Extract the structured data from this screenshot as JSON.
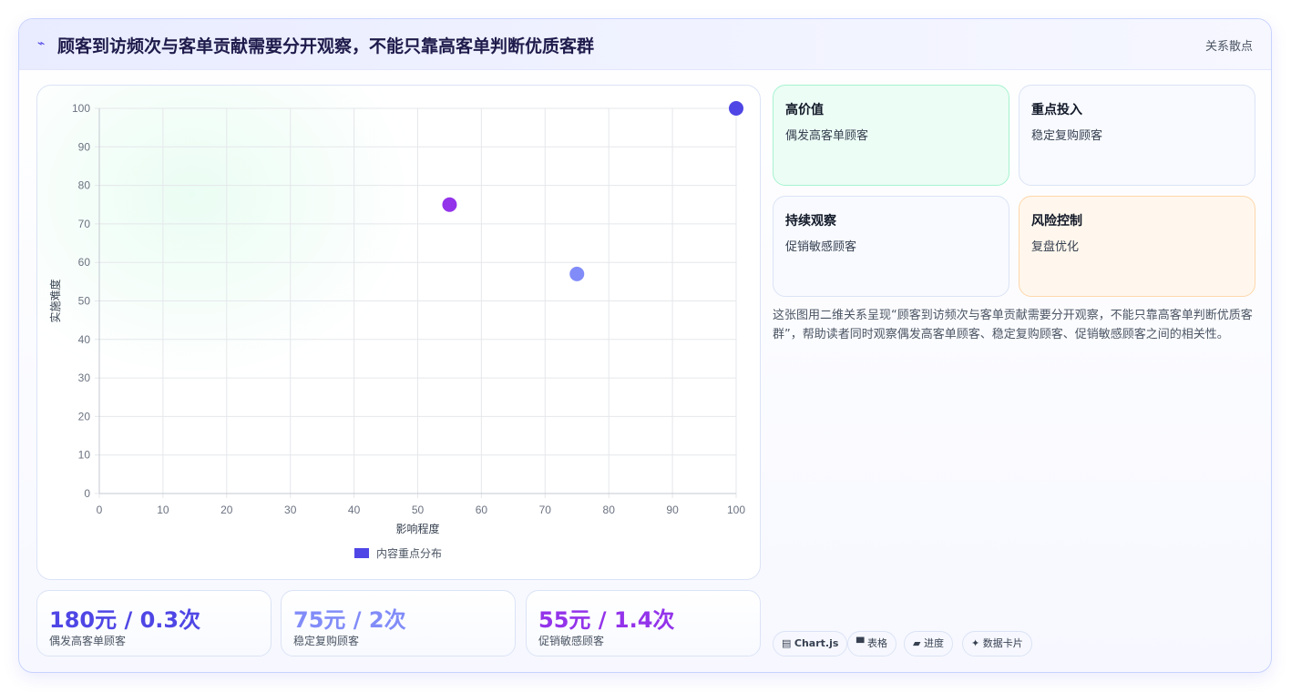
{
  "header": {
    "icon": "lightning-icon",
    "title": "顾客到访频次与客单贡献需要分开观察，不能只靠高客单判断优质客群",
    "tag": "关系散点"
  },
  "chart_data": {
    "type": "scatter",
    "xlabel": "影响程度",
    "ylabel": "实施难度",
    "xlim": [
      0,
      100
    ],
    "ylim": [
      0,
      100
    ],
    "x_ticks": [
      "0",
      "10",
      "20",
      "30",
      "40",
      "50",
      "60",
      "70",
      "80",
      "90",
      "100"
    ],
    "y_ticks": [
      "0",
      "10",
      "20",
      "30",
      "40",
      "50",
      "60",
      "70",
      "80",
      "90",
      "100"
    ],
    "grid": true,
    "legend": {
      "label": "内容重点分布",
      "placement": "bottom",
      "color": "#4f46e5"
    },
    "points": [
      {
        "x": 100,
        "y": 100,
        "color": "#4f46e5"
      },
      {
        "x": 55,
        "y": 75,
        "color": "#9333ea"
      },
      {
        "x": 75,
        "y": 57,
        "color": "#818cf8"
      }
    ]
  },
  "stats": [
    {
      "value": "180元 / 0.3次",
      "label": "偶发高客单顾客",
      "color": "#4f46e5"
    },
    {
      "value": "75元 / 2次",
      "label": "稳定复购顾客",
      "color": "#818cf8"
    },
    {
      "value": "55元 / 1.4次",
      "label": "促销敏感顾客",
      "color": "#9333ea"
    }
  ],
  "quadrants": [
    {
      "title": "高价值",
      "desc": "偶发高客单顾客",
      "bg": "#ecfdf5",
      "border": "#a7f3d0"
    },
    {
      "title": "重点投入",
      "desc": "稳定复购顾客",
      "bg": "#f8faff",
      "border": "#dbe3f5"
    },
    {
      "title": "持续观察",
      "desc": "促销敏感顾客",
      "bg": "#f8faff",
      "border": "#dbe3f5"
    },
    {
      "title": "风险控制",
      "desc": "复盘优化",
      "bg": "#fff7ed",
      "border": "#fed7aa"
    }
  ],
  "description": "这张图用二维关系呈现“顾客到访频次与客单贡献需要分开观察，不能只靠高客单判断优质客群”，帮助读者同时观察偶发高客单顾客、稳定复购顾客、促销敏感顾客之间的相关性。",
  "chips": [
    {
      "icon": "chart-icon",
      "glyph": "▤",
      "label": "Chart.js"
    },
    {
      "icon": "table-icon",
      "glyph": "▀",
      "label": "表格"
    },
    {
      "icon": "progress-icon",
      "glyph": "▰",
      "label": "进度"
    },
    {
      "icon": "sparkle-icon",
      "glyph": "✦",
      "label": "数据卡片"
    }
  ]
}
